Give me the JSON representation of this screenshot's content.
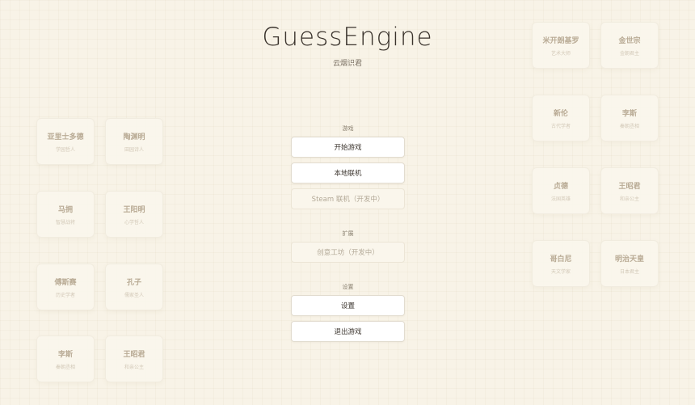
{
  "header": {
    "title": "GuessEngine",
    "subtitle": "云烟识君"
  },
  "menu": {
    "sections": {
      "game": "游戏",
      "extend": "扩展",
      "settings": "设置"
    },
    "buttons": {
      "start": "开始游戏",
      "local": "本地联机",
      "steam": "Steam 联机（开发中）",
      "workshop": "创意工坊（开发中）",
      "settings": "设置",
      "exit": "退出游戏"
    }
  },
  "cards": [
    {
      "name": "亚里士多德",
      "sub": "学园哲人"
    },
    {
      "name": "陶渊明",
      "sub": "田园诗人"
    },
    {
      "name": "马拥",
      "sub": "智慧战将"
    },
    {
      "name": "王阳明",
      "sub": "心学哲人"
    },
    {
      "name": "傅斯赛",
      "sub": "历史学者"
    },
    {
      "name": "孔子",
      "sub": "儒家圣人"
    },
    {
      "name": "李斯",
      "sub": "秦朝丞相"
    },
    {
      "name": "王昭君",
      "sub": "和亲公主"
    },
    {
      "name": "米开朗基罗",
      "sub": "艺术大师"
    },
    {
      "name": "金世宗",
      "sub": "金朝君主"
    },
    {
      "name": "新伦",
      "sub": "古代学者"
    },
    {
      "name": "李斯",
      "sub": "秦朝丞相"
    },
    {
      "name": "贞德",
      "sub": "法国英雄"
    },
    {
      "name": "王昭君",
      "sub": "和亲公主"
    },
    {
      "name": "哥白尼",
      "sub": "天文学家"
    },
    {
      "name": "明治天皇",
      "sub": "日本君主"
    }
  ]
}
